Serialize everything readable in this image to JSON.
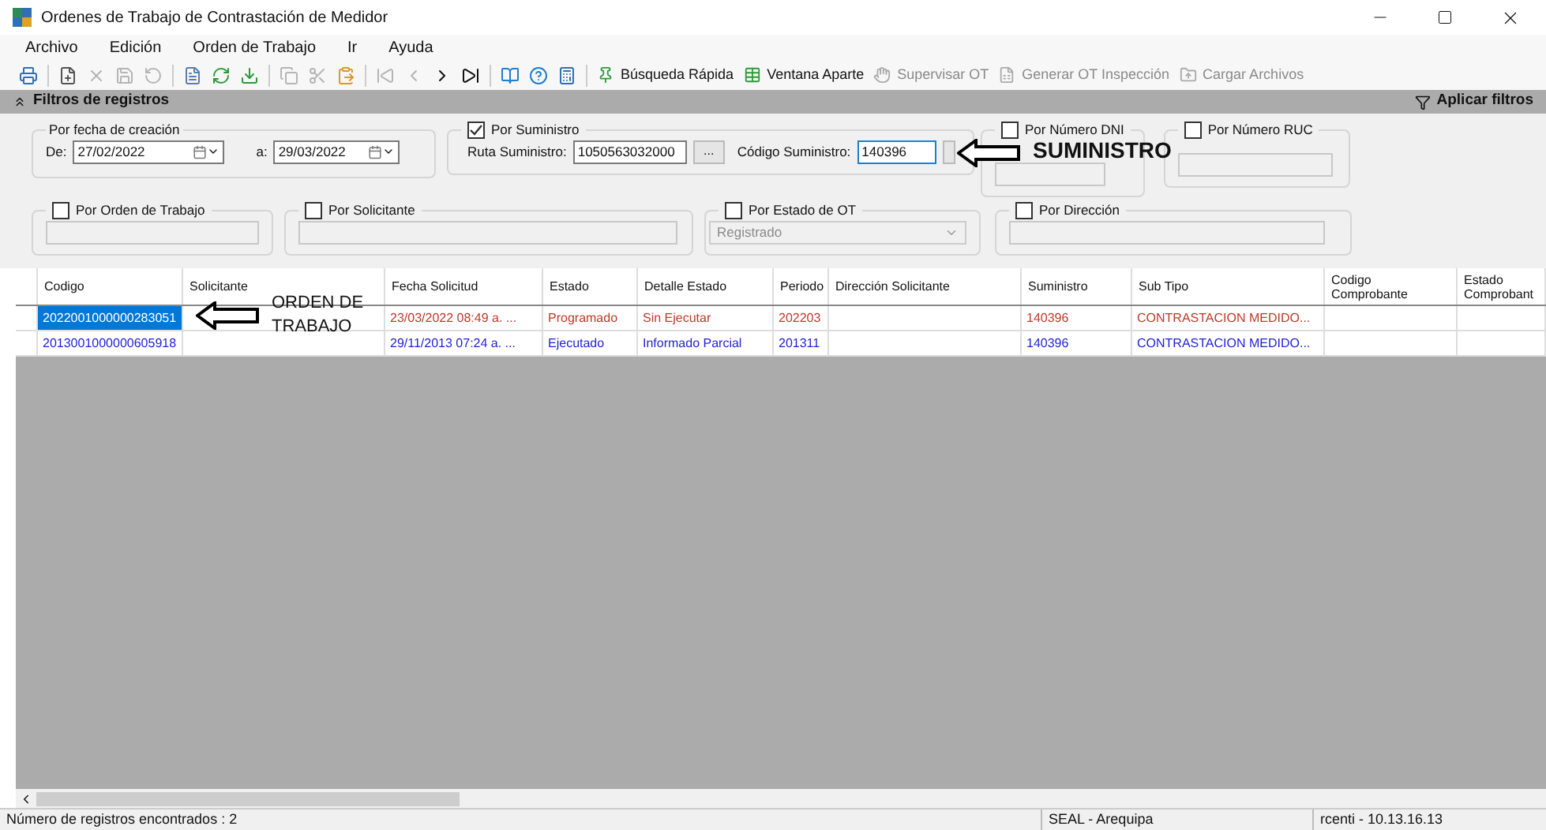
{
  "window": {
    "title": "Ordenes de Trabajo de Contrastación de Medidor"
  },
  "menu": [
    "Archivo",
    "Edición",
    "Orden de Trabajo",
    "Ir",
    "Ayuda"
  ],
  "toolbar": {
    "icon_buttons": [
      {
        "disabled": false
      },
      {
        "disabled": false
      },
      {
        "disabled": true
      },
      {
        "disabled": true
      },
      {
        "disabled": true
      },
      {
        "disabled": false
      },
      {
        "disabled": false
      },
      {
        "disabled": false
      },
      {
        "disabled": true
      },
      {
        "disabled": true
      },
      {
        "disabled": false
      },
      {
        "disabled": true
      },
      {
        "disabled": true
      },
      {
        "disabled": false
      },
      {
        "disabled": false
      },
      {
        "disabled": false
      },
      {
        "disabled": false
      },
      {
        "disabled": false
      }
    ],
    "text_buttons": [
      {
        "label": "Búsqueda Rápida",
        "disabled": false
      },
      {
        "label": "Ventana Aparte",
        "disabled": false
      },
      {
        "label": "Supervisar OT",
        "disabled": true
      },
      {
        "label": "Generar OT Inspección",
        "disabled": true
      },
      {
        "label": "Cargar Archivos",
        "disabled": true
      }
    ]
  },
  "filters": {
    "title": "Filtros de registros",
    "apply_label": "Aplicar filtros",
    "date_group": {
      "label": "Por fecha de creación",
      "from_label": "De:",
      "from": "27/02/2022",
      "to_label": "a:",
      "to": "29/03/2022"
    },
    "suministro": {
      "label": "Por Suministro",
      "checked": true,
      "ruta_label": "Ruta Suministro:",
      "ruta_value": "1050563032000",
      "browse_label": "...",
      "codigo_label": "Código Suministro:",
      "codigo_value": "140396"
    },
    "dni": {
      "label": "Por Número DNI",
      "checked": false
    },
    "ruc": {
      "label": "Por Número RUC",
      "checked": false
    },
    "orden": {
      "label": "Por Orden de Trabajo",
      "checked": false
    },
    "solicitante": {
      "label": "Por Solicitante",
      "checked": false
    },
    "estado": {
      "label": "Por Estado de OT",
      "checked": false,
      "value": "Registrado"
    },
    "direccion": {
      "label": "Por Dirección",
      "checked": false
    }
  },
  "table": {
    "columns": [
      "Codigo",
      "Solicitante",
      "Fecha Solicitud",
      "Estado",
      "Detalle Estado",
      "Periodo",
      "Dirección Solicitante",
      "Suministro",
      "Sub Tipo",
      "Codigo Comprobante",
      "Estado Comprobant"
    ],
    "rows": [
      {
        "selected": true,
        "color": "#c0392b",
        "cells": [
          "2022001000000283051",
          "",
          "23/03/2022 08:49 a. ...",
          "Programado",
          "Sin Ejecutar",
          "202203",
          "",
          "140396",
          "CONTRASTACION MEDIDO...",
          "",
          ""
        ]
      },
      {
        "selected": false,
        "color": "#1f1fd6",
        "cells": [
          "2013001000000605918",
          "",
          "29/11/2013 07:24 a. ...",
          "Ejecutado",
          "Informado Parcial",
          "201311",
          "",
          "140396",
          "CONTRASTACION MEDIDO...",
          "",
          ""
        ]
      }
    ]
  },
  "annotations": [
    {
      "kind": "suministro",
      "text": "SUMINISTRO"
    },
    {
      "kind": "orden",
      "text": "ORDEN DE TRABAJO"
    }
  ],
  "status_bar": [
    "Número de registros encontrados : 2",
    "SEAL - Arequipa",
    "rcenti - 10.13.16.13"
  ]
}
